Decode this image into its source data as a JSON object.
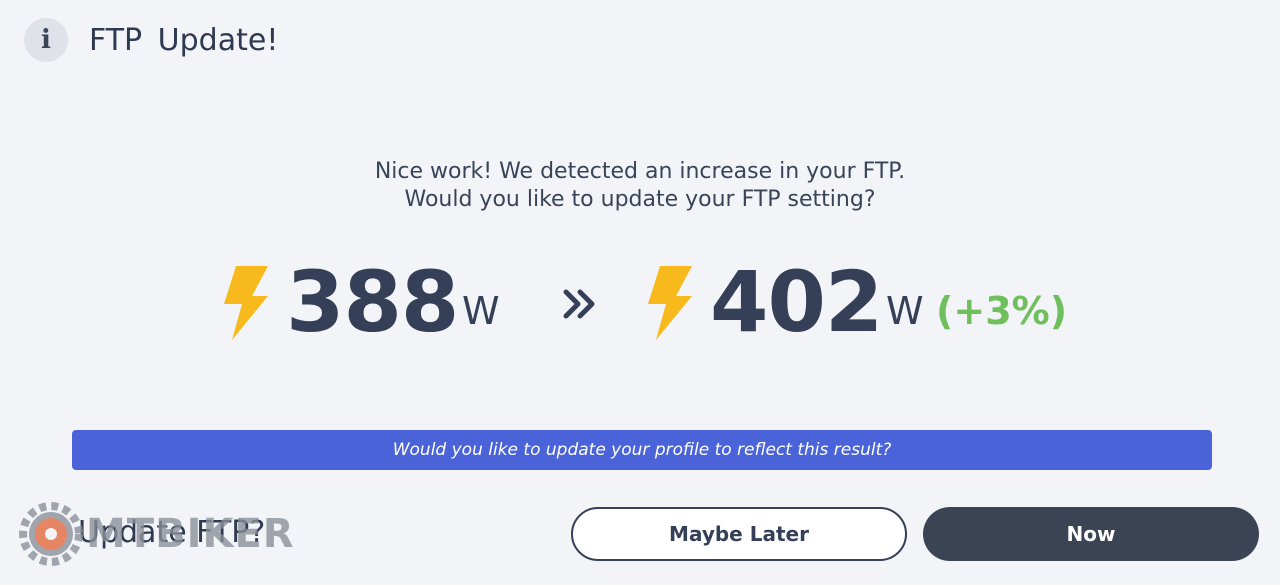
{
  "header": {
    "info_icon": "i",
    "title": "FTP  Update!"
  },
  "message": {
    "line1": "Nice work! We detected an increase in your FTP.",
    "line2": "Would you like to update your FTP setting?"
  },
  "ftp": {
    "old_value": "388",
    "old_unit": "W",
    "arrow": "»",
    "new_value": "402",
    "new_unit": "W",
    "change": "(+3%)"
  },
  "banner_text": "Would you like to update your profile to reflect this result?",
  "question": "Update FTP?",
  "watermark_text": "MTBIKER",
  "buttons": {
    "maybe_later": "Maybe Later",
    "now": "Now"
  },
  "colors": {
    "background": "#f2f4f8",
    "text_dark": "#354058",
    "bolt": "#f7b91c",
    "increase": "#6fbf5c",
    "banner": "#4a63d8",
    "primary_button": "#3a4454"
  },
  "icons": {
    "info": "info-icon",
    "bolt": "lightning-bolt-icon",
    "arrow": "double-chevron-right-icon"
  }
}
